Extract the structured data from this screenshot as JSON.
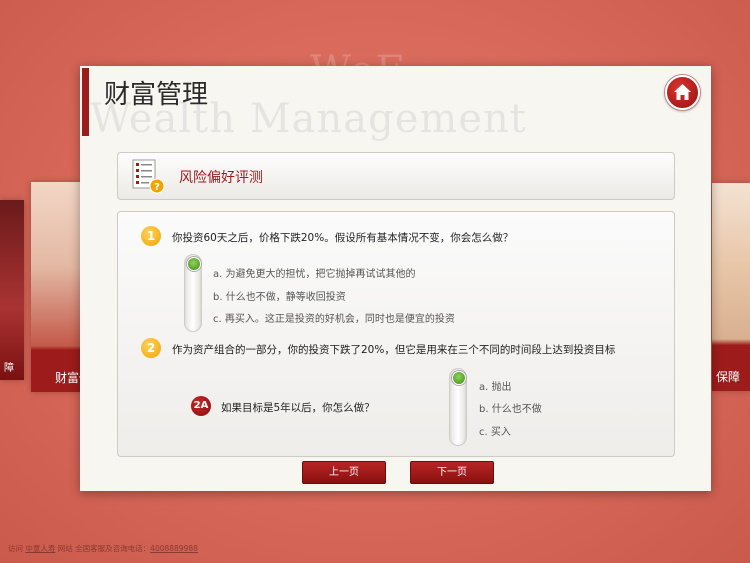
{
  "background": {
    "watermark": "WeF..."
  },
  "side_cards": {
    "left_far_label": "障",
    "left_label": "财富传",
    "right_label": "保障"
  },
  "page": {
    "title": "财富管理",
    "subtitle": "Wealth Management",
    "home_icon": "home-icon"
  },
  "section": {
    "title": "风险偏好评测",
    "icon": "questionnaire-icon"
  },
  "questions": [
    {
      "number": "1",
      "text": "你投资60天之后，价格下跌20%。假设所有基本情况不变，你会怎么做？",
      "options": [
        "a.  为避免更大的担忧，把它抛掉再试试其他的",
        "b.  什么也不做，静等收回投资",
        "c.  再买入。这正是投资的好机会，同时也是便宜的投资"
      ],
      "selected_index": 0
    },
    {
      "number": "2",
      "text": "作为资产组合的一部分，你的投资下跌了20%，但它是用来在三个不同的时间段上达到投资目标"
    },
    {
      "number": "2A",
      "text": "如果目标是5年以后，你怎么做？",
      "options": [
        "a.  抛出",
        "b.  什么也不做",
        "c.  买入"
      ],
      "selected_index": 0
    }
  ],
  "nav": {
    "prev_label": "上一页",
    "next_label": "下一页"
  },
  "footer": {
    "visit_label": "访问",
    "link_text": "中意人寿",
    "site_label": "网站",
    "hotline_label": "全国客服及咨询电话：",
    "phone": "4008889988"
  },
  "colors": {
    "accent": "#9d1b1b",
    "background": "#d8685a",
    "badge_yellow": "#f0a400",
    "knob_green": "#5aa82a"
  }
}
